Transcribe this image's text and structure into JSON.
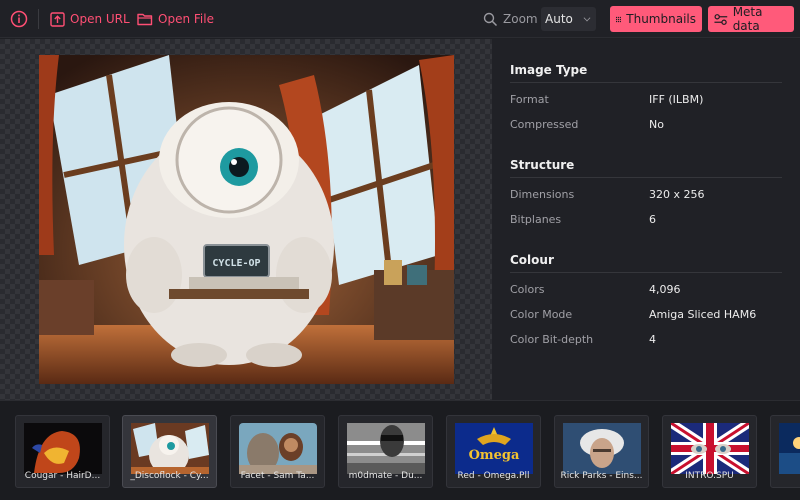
{
  "toolbar": {
    "open_url_label": "Open URL",
    "open_file_label": "Open File",
    "zoom_label": "Zoom",
    "zoom_value": "Auto",
    "thumbnails_label": "Thumbnails",
    "meta_label": "Meta data",
    "accent_color": "#ff5a7a"
  },
  "main_image": {
    "badge_text": "CYCLE-OP"
  },
  "info": {
    "sections": [
      {
        "title": "Image Type",
        "rows": [
          {
            "key": "Format",
            "value": "IFF (ILBM)"
          },
          {
            "key": "Compressed",
            "value": "No"
          }
        ]
      },
      {
        "title": "Structure",
        "rows": [
          {
            "key": "Dimensions",
            "value": "320 x 256"
          },
          {
            "key": "Bitplanes",
            "value": "6"
          }
        ]
      },
      {
        "title": "Colour",
        "rows": [
          {
            "key": "Colors",
            "value": "4,096"
          },
          {
            "key": "Color Mode",
            "value": "Amiga Sliced HAM6"
          },
          {
            "key": "Color Bit-depth",
            "value": "4"
          }
        ]
      }
    ]
  },
  "thumbnails": [
    {
      "caption": "Cougar - HairD..."
    },
    {
      "caption": "_Discoflock - Cy..."
    },
    {
      "caption": "Facet - Sam Ta..."
    },
    {
      "caption": "m0dmate - Du..."
    },
    {
      "caption": "Red - Omega.Pll"
    },
    {
      "caption": "Rick Parks - Eins..."
    },
    {
      "caption": "INTRO.SPU"
    },
    {
      "caption": ""
    }
  ],
  "thumb_texts": {
    "omega": "Omega"
  }
}
